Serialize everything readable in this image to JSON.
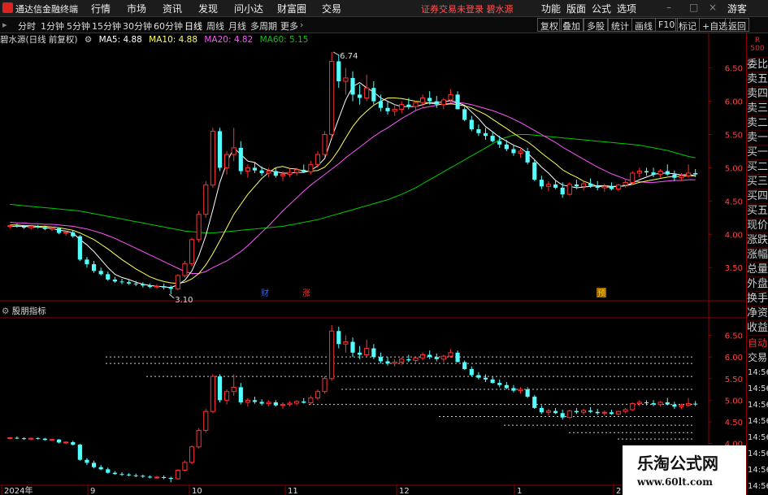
{
  "menubar": {
    "app_name": "通达信金融终端",
    "menus": [
      "行情",
      "市场",
      "资讯",
      "发现",
      "问小达",
      "财富圈",
      "交易"
    ],
    "notice": "证券交易未登录  碧水源",
    "right": [
      "功能",
      "版面",
      "公式",
      "选项",
      "游客"
    ]
  },
  "toolbar": {
    "timeframes": [
      "分时",
      "1分钟",
      "5分钟",
      "15分钟",
      "30分钟",
      "60分钟",
      "日线",
      "周线",
      "月线",
      "多周期",
      "更多"
    ],
    "active": "日线",
    "right_buttons": [
      "复权",
      "叠加",
      "多股",
      "统计",
      "画线",
      "F10",
      "标记",
      "+自选",
      "返回"
    ]
  },
  "main_chart": {
    "header": {
      "stock": "碧水源(日线 前复权)",
      "ma5": "MA5: 4.88",
      "ma10": "MA10: 4.88",
      "ma20": "MA20: 4.82",
      "ma60": "MA60: 5.15"
    },
    "high_label": "6.74",
    "low_label": "3.10",
    "markers": [
      "财",
      "涨",
      "预"
    ],
    "colors": {
      "up": "#ff3232",
      "down": "#54ffff",
      "ma5": "#ffffff",
      "ma10": "#ffff55",
      "ma20": "#ff55ff",
      "ma60": "#00cc00",
      "axis": "#8b0000"
    }
  },
  "sub_chart": {
    "title": "股朋指标"
  },
  "x_axis": [
    "2024年",
    "9",
    "10",
    "11",
    "12",
    "1",
    "2"
  ],
  "right_panel": {
    "r_label": "R",
    "r_sub": "500",
    "items": [
      "委比",
      "卖五",
      "卖四",
      "卖三",
      "卖二",
      "卖一",
      "买一",
      "买二",
      "买三",
      "买四",
      "买五",
      "现价",
      "涨跌",
      "涨幅",
      "总量",
      "外盘",
      "换手",
      "净资",
      "收益"
    ],
    "auto": "自动",
    "trade": "交易",
    "times": [
      "14:56",
      "14:56",
      "14:56",
      "14:56",
      "14:56",
      "14:56",
      "14:56",
      "14:56"
    ]
  },
  "watermark": {
    "line1": "乐淘公式网",
    "line2": "www.60lt.com"
  },
  "chart_data": {
    "type": "candlestick",
    "price_axis_main": [
      6.5,
      6.0,
      5.5,
      5.0,
      4.5,
      4.0,
      3.5
    ],
    "price_axis_sub": [
      6.5,
      6.0,
      5.5,
      5.0,
      4.5,
      4.0
    ],
    "ohlc": [
      [
        4.12,
        4.15,
        4.09,
        4.13
      ],
      [
        4.13,
        4.16,
        4.1,
        4.12
      ],
      [
        4.12,
        4.14,
        4.08,
        4.1
      ],
      [
        4.1,
        4.13,
        4.07,
        4.12
      ],
      [
        4.12,
        4.14,
        4.09,
        4.11
      ],
      [
        4.11,
        4.13,
        4.06,
        4.08
      ],
      [
        4.08,
        4.11,
        4.05,
        4.09
      ],
      [
        4.09,
        4.1,
        4.0,
        4.02
      ],
      [
        4.02,
        4.05,
        3.98,
        4.03
      ],
      [
        4.03,
        4.06,
        3.95,
        3.97
      ],
      [
        3.97,
        3.99,
        3.6,
        3.62
      ],
      [
        3.62,
        3.66,
        3.5,
        3.55
      ],
      [
        3.55,
        3.6,
        3.42,
        3.45
      ],
      [
        3.45,
        3.5,
        3.38,
        3.4
      ],
      [
        3.4,
        3.44,
        3.3,
        3.32
      ],
      [
        3.32,
        3.36,
        3.27,
        3.29
      ],
      [
        3.29,
        3.33,
        3.25,
        3.28
      ],
      [
        3.28,
        3.31,
        3.24,
        3.26
      ],
      [
        3.26,
        3.3,
        3.22,
        3.25
      ],
      [
        3.25,
        3.28,
        3.2,
        3.23
      ],
      [
        3.23,
        3.26,
        3.19,
        3.21
      ],
      [
        3.21,
        3.25,
        3.18,
        3.22
      ],
      [
        3.22,
        3.26,
        3.17,
        3.2
      ],
      [
        3.2,
        3.23,
        3.1,
        3.18
      ],
      [
        3.18,
        3.4,
        3.16,
        3.38
      ],
      [
        3.38,
        3.6,
        3.35,
        3.56
      ],
      [
        3.56,
        3.95,
        3.52,
        3.92
      ],
      [
        3.92,
        4.35,
        3.88,
        4.3
      ],
      [
        4.3,
        4.8,
        4.25,
        4.74
      ],
      [
        4.74,
        5.6,
        4.7,
        5.55
      ],
      [
        5.55,
        5.6,
        4.95,
        5.0
      ],
      [
        5.0,
        5.25,
        4.9,
        5.2
      ],
      [
        5.2,
        5.6,
        5.1,
        5.3
      ],
      [
        5.3,
        5.4,
        4.9,
        4.95
      ],
      [
        4.95,
        5.05,
        4.85,
        5.0
      ],
      [
        5.0,
        5.08,
        4.92,
        4.96
      ],
      [
        4.96,
        5.02,
        4.88,
        4.92
      ],
      [
        4.92,
        5.0,
        4.86,
        4.95
      ],
      [
        4.95,
        5.0,
        4.85,
        4.88
      ],
      [
        4.88,
        4.95,
        4.8,
        4.9
      ],
      [
        4.9,
        4.98,
        4.86,
        4.93
      ],
      [
        4.93,
        5.0,
        4.88,
        4.97
      ],
      [
        4.97,
        5.05,
        4.92,
        4.94
      ],
      [
        4.94,
        5.1,
        4.9,
        5.05
      ],
      [
        5.05,
        5.25,
        5.0,
        5.2
      ],
      [
        5.2,
        5.55,
        5.15,
        5.5
      ],
      [
        5.5,
        6.74,
        5.45,
        6.6
      ],
      [
        6.6,
        6.7,
        6.2,
        6.3
      ],
      [
        6.3,
        6.5,
        6.1,
        6.35
      ],
      [
        6.35,
        6.45,
        6.0,
        6.1
      ],
      [
        6.1,
        6.25,
        5.95,
        6.05
      ],
      [
        6.05,
        6.4,
        6.0,
        6.2
      ],
      [
        6.2,
        6.3,
        5.95,
        6.0
      ],
      [
        6.0,
        6.1,
        5.85,
        5.9
      ],
      [
        5.9,
        6.0,
        5.8,
        5.85
      ],
      [
        5.85,
        5.95,
        5.78,
        5.88
      ],
      [
        5.88,
        6.0,
        5.82,
        5.95
      ],
      [
        5.95,
        6.05,
        5.88,
        5.92
      ],
      [
        5.92,
        6.0,
        5.85,
        5.98
      ],
      [
        5.98,
        6.1,
        5.92,
        6.05
      ],
      [
        6.05,
        6.15,
        5.95,
        6.0
      ],
      [
        6.0,
        6.08,
        5.9,
        5.95
      ],
      [
        5.95,
        6.05,
        5.88,
        6.02
      ],
      [
        6.02,
        6.18,
        5.98,
        6.1
      ],
      [
        6.1,
        6.15,
        5.9,
        5.88
      ],
      [
        5.88,
        5.92,
        5.7,
        5.72
      ],
      [
        5.72,
        5.78,
        5.55,
        5.58
      ],
      [
        5.58,
        5.65,
        5.48,
        5.52
      ],
      [
        5.52,
        5.6,
        5.42,
        5.48
      ],
      [
        5.48,
        5.55,
        5.38,
        5.4
      ],
      [
        5.4,
        5.48,
        5.3,
        5.35
      ],
      [
        5.35,
        5.42,
        5.25,
        5.28
      ],
      [
        5.28,
        5.35,
        5.18,
        5.22
      ],
      [
        5.22,
        5.3,
        5.15,
        5.25
      ],
      [
        5.25,
        5.3,
        5.05,
        5.08
      ],
      [
        5.08,
        5.12,
        4.8,
        4.82
      ],
      [
        4.82,
        4.88,
        4.68,
        4.72
      ],
      [
        4.72,
        4.8,
        4.65,
        4.75
      ],
      [
        4.75,
        4.82,
        4.68,
        4.7
      ],
      [
        4.7,
        4.78,
        4.55,
        4.6
      ],
      [
        4.6,
        4.78,
        4.58,
        4.75
      ],
      [
        4.75,
        4.82,
        4.68,
        4.72
      ],
      [
        4.72,
        4.8,
        4.66,
        4.76
      ],
      [
        4.76,
        4.84,
        4.7,
        4.73
      ],
      [
        4.73,
        4.8,
        4.66,
        4.7
      ],
      [
        4.7,
        4.76,
        4.64,
        4.72
      ],
      [
        4.72,
        4.78,
        4.66,
        4.68
      ],
      [
        4.68,
        4.76,
        4.65,
        4.74
      ],
      [
        4.74,
        4.82,
        4.7,
        4.78
      ],
      [
        4.78,
        4.95,
        4.75,
        4.92
      ],
      [
        4.92,
        5.0,
        4.86,
        4.95
      ],
      [
        4.95,
        5.0,
        4.88,
        4.93
      ],
      [
        4.93,
        5.0,
        4.86,
        4.9
      ],
      [
        4.9,
        4.98,
        4.85,
        4.95
      ],
      [
        4.95,
        5.05,
        4.88,
        4.9
      ],
      [
        4.9,
        4.96,
        4.8,
        4.85
      ],
      [
        4.85,
        4.92,
        4.8,
        4.88
      ],
      [
        4.88,
        5.05,
        4.85,
        4.92
      ],
      [
        4.92,
        4.98,
        4.86,
        4.9
      ]
    ],
    "ma": {
      "ma5": [
        4.12,
        4.12,
        4.12,
        4.11,
        4.11,
        4.1,
        4.09,
        4.06,
        4.05,
        4.02,
        3.92,
        3.84,
        3.74,
        3.62,
        3.5,
        3.4,
        3.35,
        3.32,
        3.28,
        3.25,
        3.23,
        3.22,
        3.21,
        3.2,
        3.24,
        3.31,
        3.45,
        3.68,
        3.98,
        4.37,
        4.78,
        5.08,
        5.3,
        5.2,
        5.1,
        5.08,
        5.0,
        4.96,
        4.94,
        4.92,
        4.92,
        4.93,
        4.93,
        4.96,
        5.03,
        5.14,
        5.45,
        5.74,
        6.02,
        6.22,
        6.28,
        6.2,
        6.14,
        6.05,
        6.0,
        5.95,
        5.92,
        5.92,
        5.92,
        5.95,
        5.98,
        5.98,
        5.99,
        6.01,
        5.98,
        5.94,
        5.84,
        5.74,
        5.62,
        5.54,
        5.46,
        5.4,
        5.34,
        5.3,
        5.22,
        5.12,
        5.01,
        4.92,
        4.81,
        4.74,
        4.72,
        4.7,
        4.71,
        4.72,
        4.73,
        4.73,
        4.72,
        4.72,
        4.73,
        4.77,
        4.82,
        4.86,
        4.9,
        4.92,
        4.92,
        4.91,
        4.89,
        4.9,
        4.88
      ],
      "ma10": [
        4.14,
        4.14,
        4.13,
        4.13,
        4.12,
        4.12,
        4.11,
        4.1,
        4.08,
        4.06,
        4.02,
        3.97,
        3.92,
        3.85,
        3.78,
        3.7,
        3.62,
        3.55,
        3.48,
        3.42,
        3.36,
        3.32,
        3.29,
        3.27,
        3.26,
        3.28,
        3.33,
        3.41,
        3.54,
        3.71,
        3.9,
        4.1,
        4.3,
        4.45,
        4.6,
        4.72,
        4.84,
        4.93,
        5.0,
        5.02,
        4.99,
        4.98,
        4.95,
        4.95,
        4.96,
        5.01,
        5.12,
        5.27,
        5.45,
        5.62,
        5.75,
        5.85,
        5.94,
        6.0,
        6.05,
        6.05,
        6.04,
        6.02,
        6.0,
        5.99,
        5.97,
        5.96,
        5.95,
        5.96,
        5.95,
        5.93,
        5.9,
        5.85,
        5.8,
        5.73,
        5.66,
        5.59,
        5.52,
        5.45,
        5.39,
        5.31,
        5.22,
        5.14,
        5.06,
        4.97,
        4.91,
        4.86,
        4.8,
        4.76,
        4.72,
        4.71,
        4.71,
        4.72,
        4.73,
        4.75,
        4.78,
        4.8,
        4.82,
        4.84,
        4.86,
        4.87,
        4.87,
        4.88,
        4.88
      ],
      "ma20": [
        4.18,
        4.17,
        4.17,
        4.16,
        4.16,
        4.15,
        4.15,
        4.14,
        4.13,
        4.12,
        4.1,
        4.08,
        4.05,
        4.02,
        3.98,
        3.94,
        3.89,
        3.84,
        3.79,
        3.74,
        3.69,
        3.64,
        3.59,
        3.54,
        3.49,
        3.44,
        3.41,
        3.41,
        3.44,
        3.5,
        3.55,
        3.6,
        3.67,
        3.74,
        3.83,
        3.93,
        4.03,
        4.13,
        4.24,
        4.35,
        4.45,
        4.55,
        4.65,
        4.74,
        4.82,
        4.9,
        4.98,
        5.06,
        5.15,
        5.23,
        5.31,
        5.39,
        5.47,
        5.54,
        5.6,
        5.67,
        5.74,
        5.8,
        5.86,
        5.9,
        5.92,
        5.94,
        5.96,
        5.97,
        5.98,
        5.97,
        5.95,
        5.92,
        5.89,
        5.86,
        5.82,
        5.78,
        5.73,
        5.68,
        5.62,
        5.56,
        5.5,
        5.44,
        5.38,
        5.31,
        5.25,
        5.19,
        5.13,
        5.07,
        5.01,
        4.96,
        4.91,
        4.87,
        4.83,
        4.8,
        4.79,
        4.78,
        4.78,
        4.79,
        4.8,
        4.81,
        4.81,
        4.82,
        4.82
      ],
      "ma60": [
        4.45,
        4.44,
        4.43,
        4.42,
        4.41,
        4.4,
        4.39,
        4.38,
        4.37,
        4.36,
        4.35,
        4.33,
        4.31,
        4.29,
        4.27,
        4.25,
        4.23,
        4.21,
        4.19,
        4.17,
        4.15,
        4.13,
        4.11,
        4.09,
        4.07,
        4.05,
        4.04,
        4.03,
        4.02,
        4.02,
        4.03,
        4.04,
        4.05,
        4.06,
        4.07,
        4.08,
        4.09,
        4.1,
        4.11,
        4.12,
        4.14,
        4.16,
        4.18,
        4.2,
        4.22,
        4.25,
        4.28,
        4.31,
        4.34,
        4.37,
        4.4,
        4.43,
        4.46,
        4.49,
        4.52,
        4.56,
        4.6,
        4.65,
        4.7,
        4.76,
        4.82,
        4.88,
        4.94,
        5.0,
        5.06,
        5.12,
        5.18,
        5.24,
        5.3,
        5.36,
        5.42,
        5.46,
        5.49,
        5.5,
        5.5,
        5.49,
        5.48,
        5.47,
        5.46,
        5.45,
        5.44,
        5.43,
        5.42,
        5.41,
        5.4,
        5.39,
        5.38,
        5.37,
        5.36,
        5.35,
        5.34,
        5.32,
        5.3,
        5.28,
        5.26,
        5.23,
        5.2,
        5.17,
        5.15
      ]
    }
  }
}
